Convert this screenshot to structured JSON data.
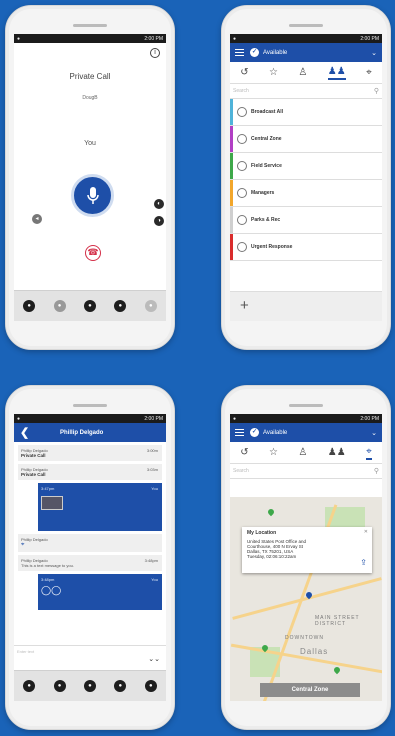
{
  "status": {
    "time": "2:00 PM"
  },
  "call_screen": {
    "title": "Private Call",
    "caller": "DougB",
    "speaker_label": "You"
  },
  "groups_screen": {
    "status_label": "Available",
    "search_placeholder": "Search",
    "groups": [
      {
        "label": "Broadcast All",
        "color": "#4fb3d9"
      },
      {
        "label": "Central Zone",
        "color": "#b13fc4"
      },
      {
        "label": "Field Service",
        "color": "#3ea84a"
      },
      {
        "label": "Managers",
        "color": "#f2a62b"
      },
      {
        "label": "Parks & Rec",
        "color": "#cfcfcf"
      },
      {
        "label": "Urgent Response",
        "color": "#d92c2c"
      }
    ],
    "add_label": "+"
  },
  "chat_screen": {
    "contact": "Phillip Delgado",
    "messages": [
      {
        "sender": "Phillip Delgado",
        "time": "3:00m",
        "body": "Private Call"
      },
      {
        "sender": "Phillip Delgado",
        "time": "3:03m",
        "body": "Private Call"
      },
      {
        "sender": "Phillip Delgado",
        "time": "3:48pm",
        "body": "This is a text message to you."
      }
    ],
    "outgoing": [
      {
        "time": "3:47pm",
        "who": "You"
      },
      {
        "time": "3:48pm",
        "who": "You"
      }
    ],
    "compose_placeholder": "Enter text"
  },
  "map_screen": {
    "status_label": "Available",
    "search_placeholder": "Search",
    "popup_title": "My Location",
    "popup_lines": [
      "United States Post Office and",
      "Courthouse, 400 N Ervay St",
      "Dallas, TX 75201, USA",
      "Tuesday, 02:06:10:22am"
    ],
    "district_label": "MAIN STREET DISTRICT",
    "downtown_label": "DOWNTOWN",
    "city_label": "Dallas",
    "zone_button": "Central Zone"
  }
}
